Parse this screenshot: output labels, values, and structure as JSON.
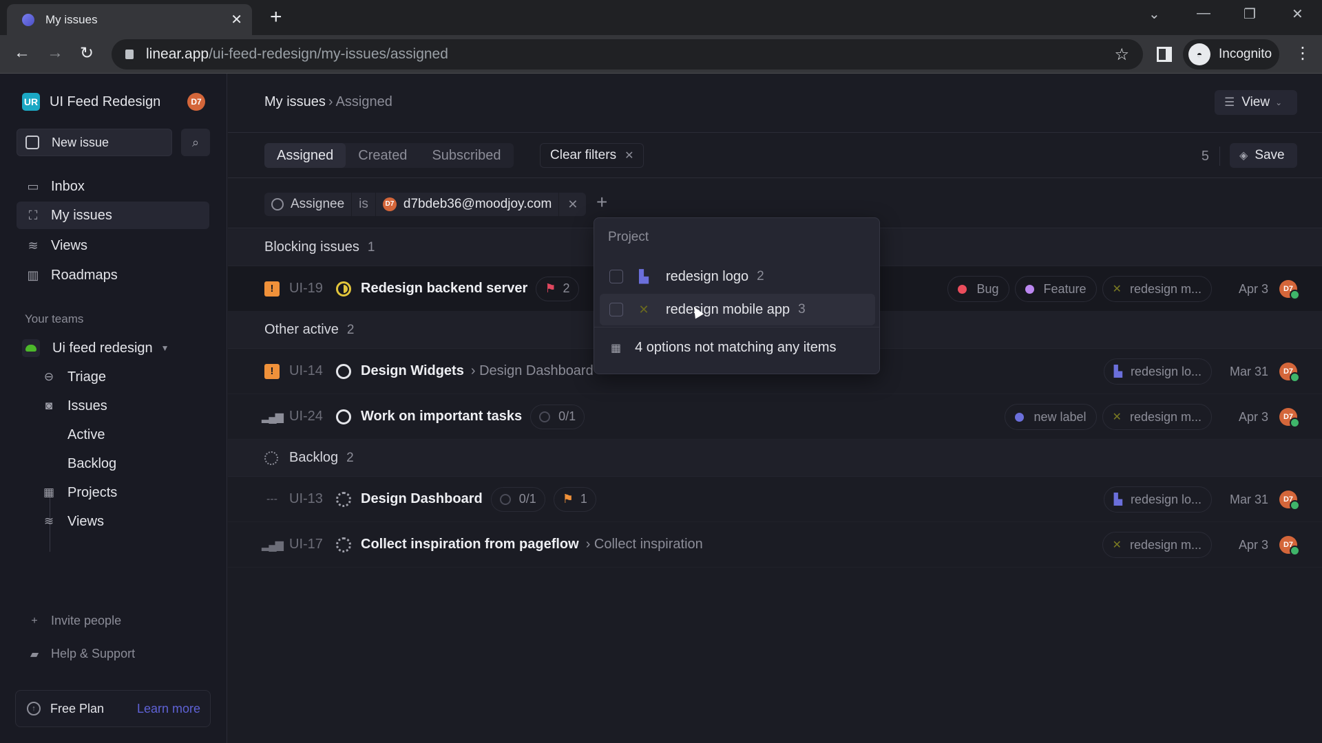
{
  "browser": {
    "tab_title": "My issues",
    "url_host": "linear.app",
    "url_path": "/ui-feed-redesign/my-issues/assigned",
    "profile_label": "Incognito"
  },
  "sidebar": {
    "workspace_initials": "UR",
    "workspace_name": "UI Feed Redesign",
    "user_initials": "D7",
    "new_issue_label": "New issue",
    "nav": [
      {
        "label": "Inbox",
        "icon": "inbox-icon"
      },
      {
        "label": "My issues",
        "icon": "my-issues-icon"
      },
      {
        "label": "Views",
        "icon": "layers-icon"
      },
      {
        "label": "Roadmaps",
        "icon": "map-icon"
      }
    ],
    "teams_label": "Your teams",
    "team_name": "Ui feed redesign",
    "team_items": [
      {
        "label": "Triage",
        "icon": "triage-icon"
      },
      {
        "label": "Issues",
        "icon": "issues-icon"
      },
      {
        "label": "Active",
        "icon": ""
      },
      {
        "label": "Backlog",
        "icon": ""
      },
      {
        "label": "Projects",
        "icon": "grid-icon"
      },
      {
        "label": "Views",
        "icon": "layers-icon"
      }
    ],
    "invite_label": "Invite people",
    "help_label": "Help & Support",
    "plan_label": "Free Plan",
    "plan_link": "Learn more"
  },
  "header": {
    "breadcrumb_root": "My issues",
    "breadcrumb_current": "Assigned",
    "view_label": "View"
  },
  "filters": {
    "tabs": [
      "Assigned",
      "Created",
      "Subscribed"
    ],
    "active_tab": "Assigned",
    "clear_label": "Clear filters",
    "count": "5",
    "save_label": "Save",
    "chip": {
      "key": "Assignee",
      "op": "is",
      "value_initials": "D7",
      "value": "d7bdeb36@moodjoy.com"
    }
  },
  "groups": [
    {
      "label": "Blocking issues",
      "count": "1"
    },
    {
      "label": "Other active",
      "count": "2"
    },
    {
      "label": "Backlog",
      "count": "2"
    }
  ],
  "issues": [
    {
      "id": "UI-19",
      "priority": "urgent",
      "status": "in-progress",
      "title": "Redesign backend server",
      "parent": "",
      "sub_progress": "",
      "relation": "2",
      "relation_color": "#e0475f",
      "labels": [
        {
          "name": "Bug",
          "color": "#eb4d5c"
        },
        {
          "name": "Feature",
          "color": "#bb87f0"
        }
      ],
      "project": "redesign m...",
      "project_icon": "mobile",
      "date": "Apr 3",
      "assignee": "D7"
    },
    {
      "id": "UI-14",
      "priority": "urgent",
      "status": "todo",
      "title": "Design Widgets",
      "parent": "Design Dashboard",
      "sub_progress": "",
      "relation": "",
      "labels": [],
      "project": "redesign lo...",
      "project_icon": "logo",
      "date": "Mar 31",
      "assignee": "D7"
    },
    {
      "id": "UI-24",
      "priority": "high",
      "status": "todo",
      "title": "Work on important tasks",
      "parent": "",
      "sub_progress": "0/1",
      "relation": "",
      "labels": [
        {
          "name": "new label",
          "color": "#6b6fdb"
        }
      ],
      "project": "redesign m...",
      "project_icon": "mobile",
      "date": "Apr 3",
      "assignee": "D7"
    },
    {
      "id": "UI-13",
      "priority": "none",
      "status": "backlog",
      "title": "Design Dashboard",
      "parent": "",
      "sub_progress": "0/1",
      "relation": "1",
      "relation_color": "#f0913a",
      "labels": [],
      "project": "redesign lo...",
      "project_icon": "logo",
      "date": "Mar 31",
      "assignee": "D7"
    },
    {
      "id": "UI-17",
      "priority": "medium",
      "status": "backlog",
      "title": "Collect inspiration from pageflow",
      "parent": "Collect inspiration",
      "sub_progress": "",
      "relation": "",
      "labels": [],
      "project": "redesign m...",
      "project_icon": "mobile",
      "date": "Apr 3",
      "assignee": "D7"
    }
  ],
  "dropdown": {
    "header": "Project",
    "options": [
      {
        "label": "redesign logo",
        "count": "2",
        "icon": "logo"
      },
      {
        "label": "redesign mobile app",
        "count": "3",
        "icon": "mobile"
      }
    ],
    "footer": "4 options not matching any items"
  },
  "colors": {
    "accent": "#5f62d6",
    "urgent": "#f0913a",
    "avatar": "#d4663a",
    "online": "#3fb56a",
    "logo_project": "#6b6fdb",
    "mobile_project": "#6b6a1e"
  }
}
